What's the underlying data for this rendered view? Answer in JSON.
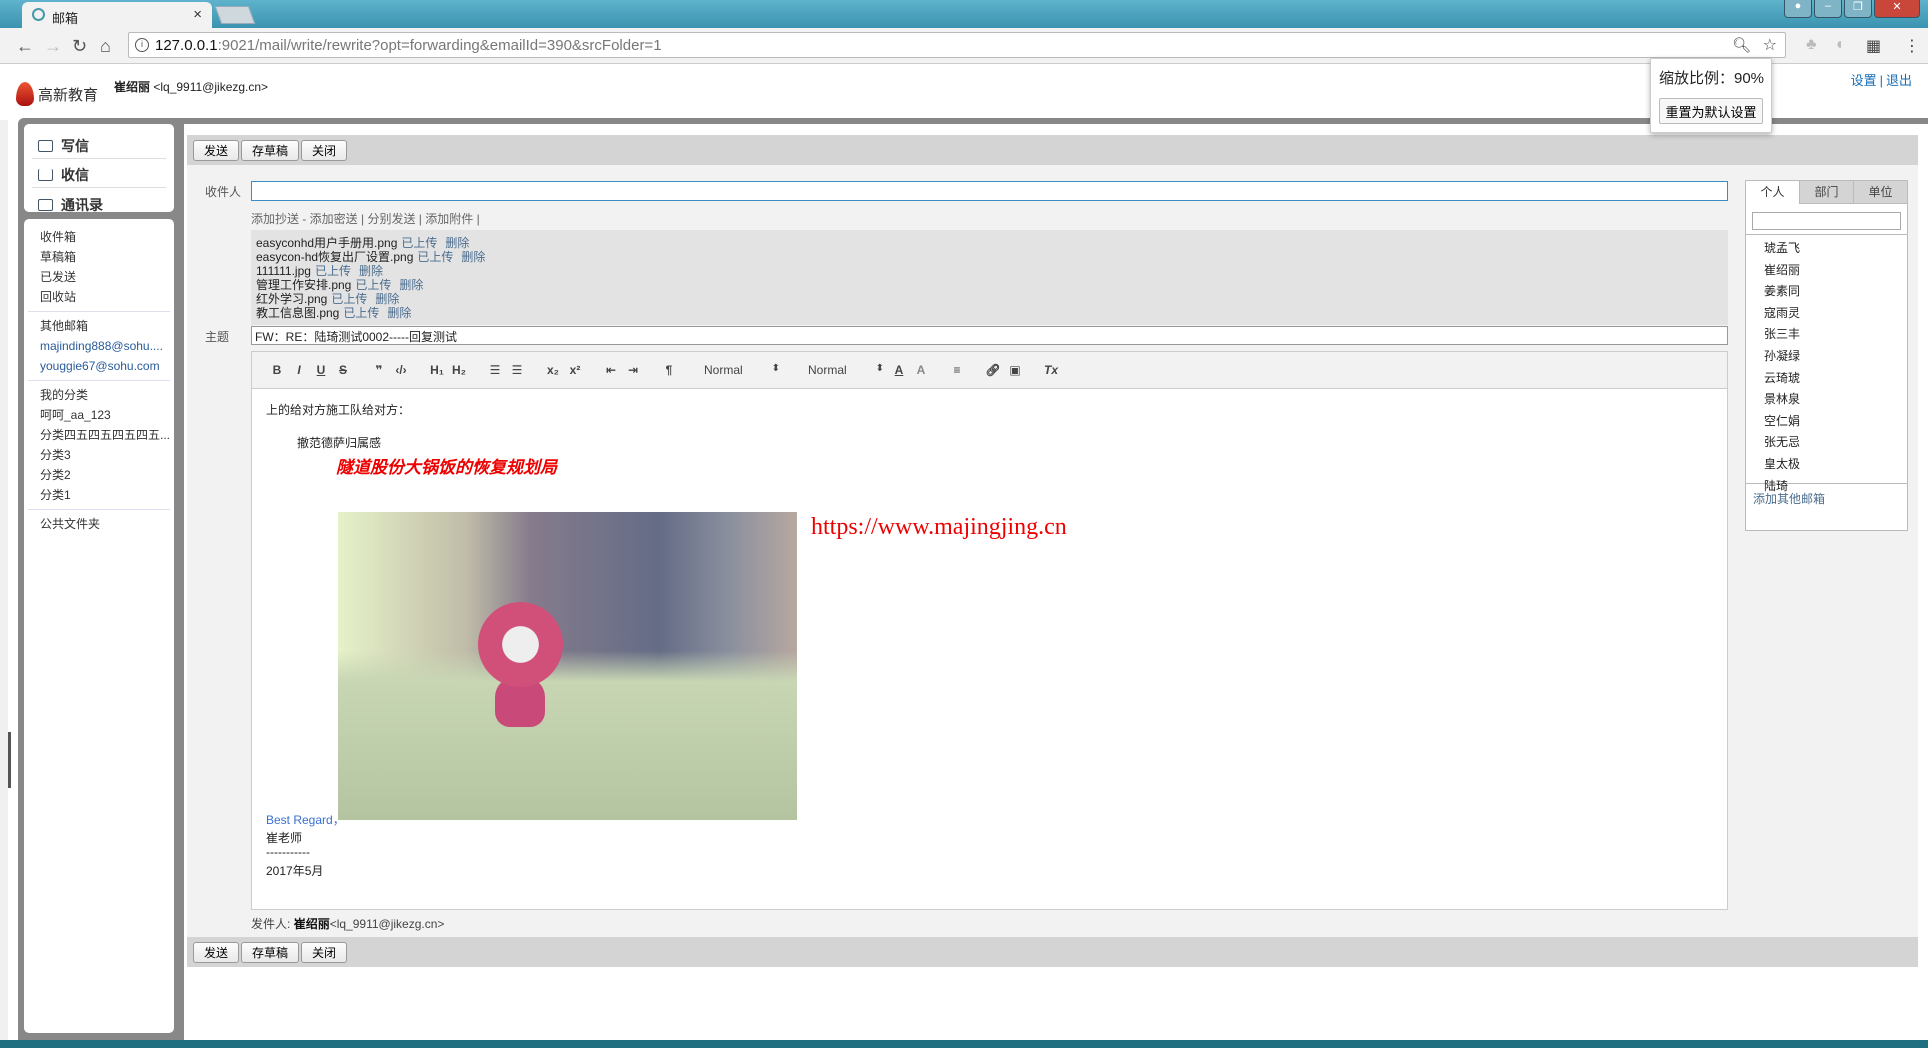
{
  "browser": {
    "tab_title": "邮箱",
    "address_host": "127.0.0.1",
    "address_rest": ":9021/mail/write/rewrite?opt=forwarding&emailId=390&srcFolder=1"
  },
  "zoom_popup": {
    "label": "缩放比例：90%",
    "reset_button": "重置为默认设置"
  },
  "header": {
    "logo_text": "高新教育",
    "user_name": "崔绍丽",
    "user_email": "<lq_9911@jikezg.cn>",
    "settings": "设置",
    "sep": "|",
    "logout": "退出"
  },
  "sidebar": {
    "actions": [
      {
        "label": "写信",
        "icon": "compose-icon"
      },
      {
        "label": "收信",
        "icon": "download-icon"
      },
      {
        "label": "通讯录",
        "icon": "contact-card-icon"
      }
    ],
    "folders": [
      "收件箱",
      "草稿箱",
      "已发送",
      "回收站"
    ],
    "other_header": "其他邮箱",
    "other_mailboxes": [
      "majinding888@sohu....",
      "youggie67@sohu.com"
    ],
    "category_header": "我的分类",
    "categories": [
      "呵呵_aa_123",
      "分类四五四五四五四五...",
      "分类3",
      "分类2",
      "分类1"
    ],
    "public": "公共文件夹"
  },
  "toolbar": {
    "send": "发送",
    "save_draft": "存草稿",
    "close": "关闭"
  },
  "compose": {
    "to_label": "收件人",
    "to_value": "",
    "links": "添加抄送 - 添加密送 | 分别发送 | 添加附件 |",
    "attachments": [
      {
        "name": "easyconhd用户手册用.png",
        "status": "已上传",
        "delete": "删除"
      },
      {
        "name": "easycon-hd恢复出厂设置.png",
        "status": "已上传",
        "delete": "删除"
      },
      {
        "name": "111111.jpg",
        "status": "已上传",
        "delete": "删除"
      },
      {
        "name": "管理工作安排.png",
        "status": "已上传",
        "delete": "删除"
      },
      {
        "name": "红外学习.png",
        "status": "已上传",
        "delete": "删除"
      },
      {
        "name": "教工信息图.png",
        "status": "已上传",
        "delete": "删除"
      }
    ],
    "subject_label": "主题",
    "subject_value": "FW：RE：陆琦测试0002-----回复测试",
    "editor_toolbar": {
      "header_select": "Normal",
      "size_select": "Normal"
    },
    "body": {
      "line1": "上的给对方施工队给对方：",
      "line2": "撤范德萨归属感",
      "red_heading": "隧道股份大锅饭的恢复规划局",
      "url": "https://www.majingjing.cn",
      "sig1": "Best Regard，",
      "sig2": "崔老师",
      "sig3": "-----------",
      "sig4": "2017年5月"
    },
    "sender_label": "发件人:",
    "sender_name": "崔绍丽",
    "sender_email": "<lq_9911@jikezg.cn>"
  },
  "contacts": {
    "tabs": [
      "个人",
      "部门",
      "单位"
    ],
    "search_value": "",
    "names": [
      "琥孟飞",
      "崔绍丽",
      "姜素同",
      "寇雨灵",
      "张三丰",
      "孙凝绿",
      "云琦琥",
      "景林泉",
      "空仁娟",
      "张无忌",
      "皇太极",
      "陆琦"
    ],
    "add_other": "添加其他邮箱"
  }
}
